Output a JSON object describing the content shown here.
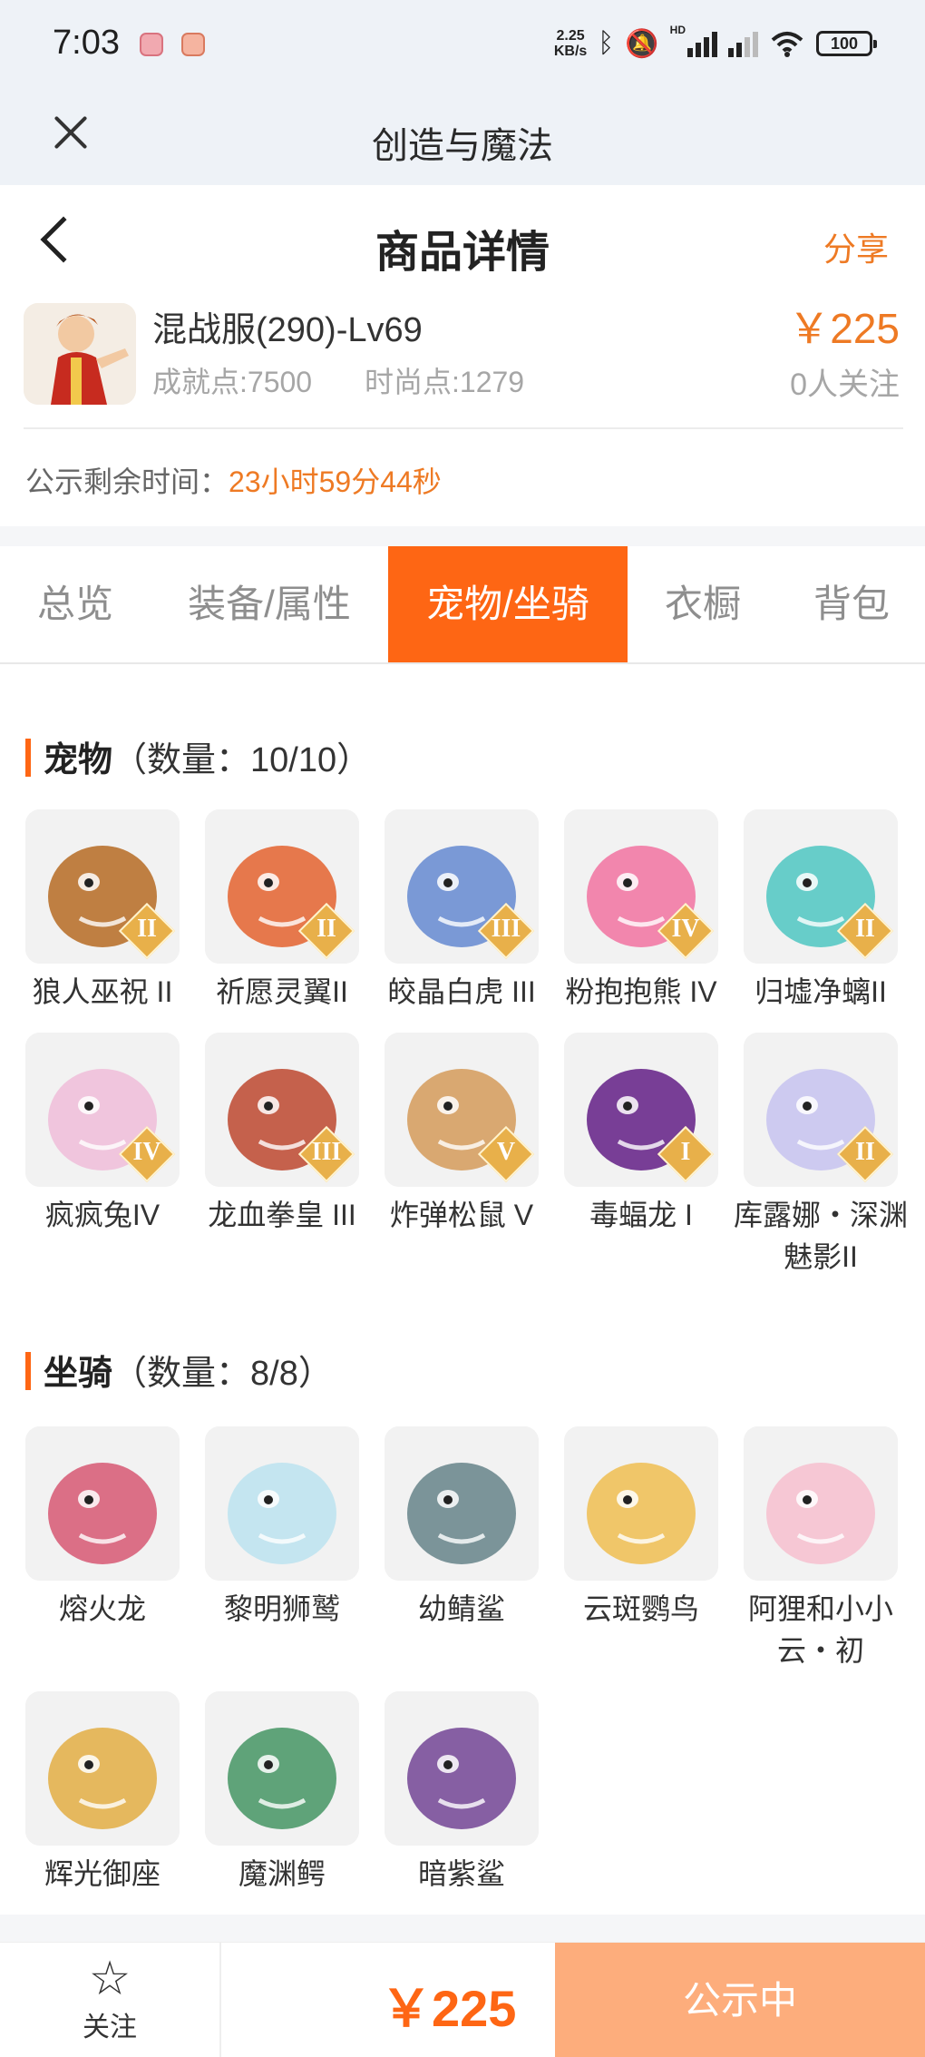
{
  "status_bar": {
    "time": "7:03",
    "net_speed_top": "2.25",
    "net_speed_bottom": "KB/s",
    "hd_label": "HD",
    "battery": "100"
  },
  "app_bar": {
    "title": "创造与魔法"
  },
  "header": {
    "title": "商品详情",
    "share": "分享"
  },
  "product": {
    "name": "混战服(290)-Lv69",
    "achievement": "成就点:7500",
    "fashion": "时尚点:1279",
    "price": "￥225",
    "followers": "0人关注"
  },
  "countdown": {
    "label": "公示剩余时间：",
    "value": "23小时59分44秒"
  },
  "tabs": [
    "总览",
    "装备/属性",
    "宠物/坐骑",
    "衣橱",
    "背包"
  ],
  "active_tab": "宠物/坐骑",
  "pets": {
    "title": "宠物",
    "count": "（数量：10/10）",
    "items": [
      {
        "name": "狼人巫祝 II",
        "badge": "II",
        "color": "#b9722f"
      },
      {
        "name": "祈愿灵翼II",
        "badge": "II",
        "color": "#e46a3a"
      },
      {
        "name": "皎晶白虎 III",
        "badge": "III",
        "color": "#6d8fd3"
      },
      {
        "name": "粉抱抱熊 IV",
        "badge": "IV",
        "color": "#f27aa5"
      },
      {
        "name": "归墟净螭II",
        "badge": "II",
        "color": "#58c9c4"
      },
      {
        "name": "疯疯兔IV",
        "badge": "IV",
        "color": "#f0c0da"
      },
      {
        "name": "龙血拳皇 III",
        "badge": "III",
        "color": "#c0513a"
      },
      {
        "name": "炸弹松鼠 V",
        "badge": "V",
        "color": "#d6a063"
      },
      {
        "name": "毒蝠龙 I",
        "badge": "I",
        "color": "#6a2a8c"
      },
      {
        "name": "库露娜・深渊魅影II",
        "badge": "II",
        "color": "#c9c5ef"
      }
    ]
  },
  "mounts": {
    "title": "坐骑",
    "count": "（数量：8/8）",
    "items": [
      {
        "name": "熔火龙",
        "color": "#d8617a"
      },
      {
        "name": "黎明狮鹫",
        "color": "#bfe3ef"
      },
      {
        "name": "幼鲭鲨",
        "color": "#6e8a8f"
      },
      {
        "name": "云斑鹦鸟",
        "color": "#f0c15a"
      },
      {
        "name": "阿狸和小小云・初",
        "color": "#f6c2d0"
      },
      {
        "name": "辉光御座",
        "color": "#e3b14e"
      },
      {
        "name": "魔渊鳄",
        "color": "#4f9a6b"
      },
      {
        "name": "暗紫鲨",
        "color": "#7a4f9a"
      }
    ]
  },
  "bottom_bar": {
    "follow": "关注",
    "price": "￥225",
    "status": "公示中"
  },
  "colors": {
    "accent": "#fe6614",
    "price": "#ee7a24",
    "status_button": "#fdad7c"
  }
}
